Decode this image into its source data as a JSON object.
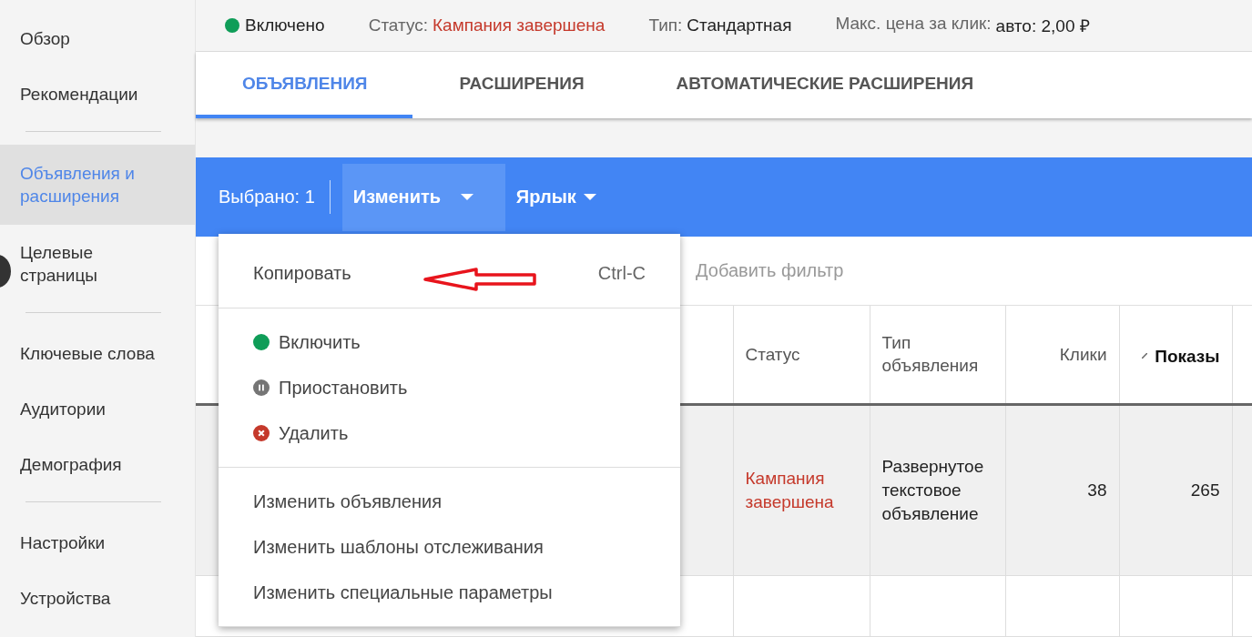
{
  "sidebar": {
    "groups": [
      [
        {
          "label": "Обзор",
          "selected": false
        },
        {
          "label": "Рекомендации",
          "selected": false
        }
      ],
      [
        {
          "label": "Объявления и расширения",
          "selected": true
        },
        {
          "label": "Целевые страницы",
          "selected": false
        }
      ],
      [
        {
          "label": "Ключевые слова",
          "selected": false
        },
        {
          "label": "Аудитории",
          "selected": false
        },
        {
          "label": "Демография",
          "selected": false
        }
      ],
      [
        {
          "label": "Настройки",
          "selected": false
        },
        {
          "label": "Устройства",
          "selected": false
        }
      ]
    ]
  },
  "header": {
    "enabled": {
      "text": "Включено",
      "color": "#0f9d58"
    },
    "fields": [
      {
        "label": "Статус:",
        "value": "Кампания завершена",
        "kind": "error"
      },
      {
        "label": "Тип:",
        "value": "Стандартная",
        "kind": "plain"
      },
      {
        "label": "Макс. цена за клик:",
        "value": "авто: 2,00 ₽",
        "kind": "plain"
      }
    ]
  },
  "tabs": [
    {
      "label": "ОБЪЯВЛЕНИЯ",
      "selected": true
    },
    {
      "label": "РАСШИРЕНИЯ",
      "selected": false
    },
    {
      "label": "АВТОМАТИЧЕСКИЕ РАСШИРЕНИЯ",
      "selected": false
    }
  ],
  "toolbar": {
    "selection": "Выбрано: 1",
    "menus": [
      {
        "label": "Изменить",
        "expanded": true
      },
      {
        "label": "Ярлык",
        "expanded": false
      }
    ]
  },
  "filter": {
    "placeholder": "Добавить фильтр"
  },
  "table": {
    "columns": [
      {
        "label": "Статус",
        "sorted": false,
        "kind": "text"
      },
      {
        "label": "Тип объявления",
        "sorted": false,
        "kind": "text"
      },
      {
        "label": "Клики",
        "sorted": false,
        "kind": "number"
      },
      {
        "label": "Показы",
        "sorted": true,
        "kind": "number"
      }
    ],
    "rows": [
      {
        "selected": true,
        "cells": [
          {
            "text": "Кампания завершена",
            "kind": "error"
          },
          {
            "text": "Развернутое текстовое объявление",
            "kind": "text"
          },
          {
            "text": "38",
            "kind": "number"
          },
          {
            "text": "265",
            "kind": "number"
          }
        ]
      }
    ]
  },
  "menu": {
    "sections": [
      [
        {
          "kind": "shortcut",
          "label": "Копировать",
          "shortcut": "Ctrl-C"
        }
      ],
      [
        {
          "kind": "enable",
          "label": "Включить",
          "color": "#0f9d58"
        },
        {
          "kind": "pause",
          "label": "Приостановить",
          "color": "#757575"
        },
        {
          "kind": "remove",
          "label": "Удалить",
          "color": "#c5392b"
        }
      ],
      [
        {
          "kind": "plain",
          "label": "Изменить объявления"
        },
        {
          "kind": "plain",
          "label": "Изменить шаблоны отслеживания"
        },
        {
          "kind": "plain",
          "label": "Изменить специальные параметры"
        }
      ]
    ]
  }
}
